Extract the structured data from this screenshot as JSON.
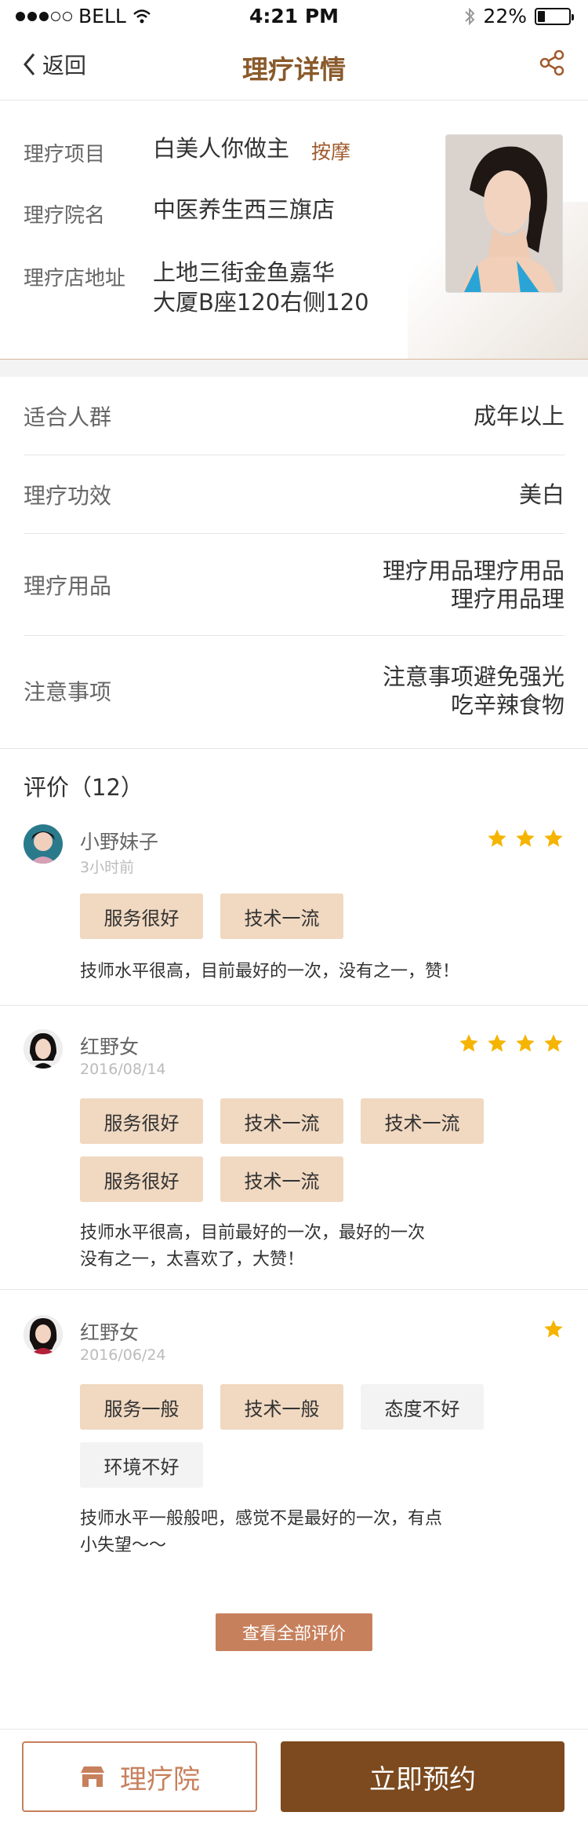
{
  "status_bar": {
    "carrier": "BELL",
    "time": "4:21 PM",
    "battery": "22%"
  },
  "nav": {
    "back_label": "返回",
    "title": "理疗详情"
  },
  "info": {
    "project_label": "理疗项目",
    "project_name": "白美人你做主",
    "project_tag": "按摩",
    "clinic_label": "理疗院名",
    "clinic_name": "中医养生西三旗店",
    "address_label": "理疗店地址",
    "address_line1": "上地三街金鱼嘉华",
    "address_line2": "大厦B座120右侧120"
  },
  "attributes": [
    {
      "key": "适合人群",
      "lines": [
        "成年以上"
      ]
    },
    {
      "key": "理疗功效",
      "lines": [
        "美白"
      ]
    },
    {
      "key": "理疗用品",
      "lines": [
        "理疗用品理疗用品",
        "理疗用品理"
      ]
    },
    {
      "key": "注意事项",
      "lines": [
        "注意事项避免强光",
        "吃辛辣食物"
      ]
    }
  ],
  "reviews_title": "评价（12）",
  "reviews": [
    {
      "name": "小野妹子",
      "date": "3小时前",
      "rating": 3,
      "tags": [
        {
          "label": "服务很好",
          "style": "brown"
        },
        {
          "label": "技术一流",
          "style": "brown"
        }
      ],
      "text_lines": [
        "技师水平很高，目前最好的一次，没有之一，赞！"
      ]
    },
    {
      "name": "红野女",
      "date": "2016/08/14",
      "rating": 4,
      "tags": [
        {
          "label": "服务很好",
          "style": "brown"
        },
        {
          "label": "技术一流",
          "style": "brown"
        },
        {
          "label": "技术一流",
          "style": "brown"
        },
        {
          "label": "服务很好",
          "style": "brown"
        },
        {
          "label": "技术一流",
          "style": "brown"
        }
      ],
      "text_lines": [
        "技师水平很高，目前最好的一次，最好的一次",
        "没有之一，太喜欢了，大赞！"
      ]
    },
    {
      "name": "红野女",
      "date": "2016/06/24",
      "rating": 1,
      "tags": [
        {
          "label": "服务一般",
          "style": "brown"
        },
        {
          "label": "技术一般",
          "style": "brown"
        },
        {
          "label": "态度不好",
          "style": "grey"
        },
        {
          "label": "环境不好",
          "style": "grey"
        }
      ],
      "text_lines": [
        "技师水平一般般吧，感觉不是最好的一次，有点",
        "小失望～～"
      ]
    }
  ],
  "view_all_label": "查看全部评价",
  "bottom_bar": {
    "store_label": "理疗院",
    "book_label": "立即预约"
  },
  "colors": {
    "brand_brown": "#7c4a1e",
    "accent": "#c7805c",
    "tag_bg": "#f0d8c1",
    "star": "#f5b400"
  },
  "icons": {
    "back": "chevron-left-icon",
    "share": "share-icon",
    "store": "store-icon",
    "star": "star-icon"
  }
}
